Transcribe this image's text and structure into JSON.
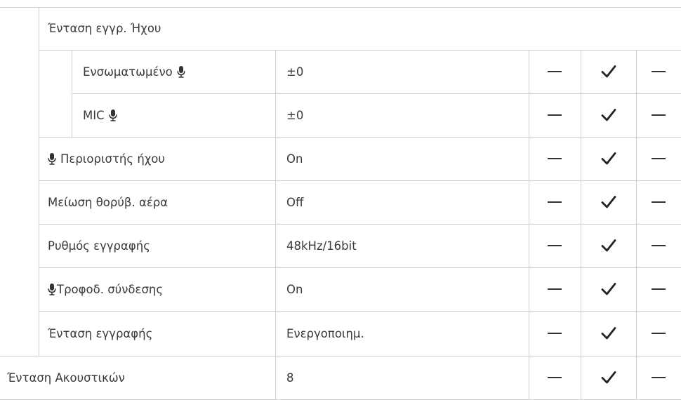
{
  "section_header": "Ένταση εγγρ. Ήχου",
  "columns": {
    "col1": "—",
    "col2": "check",
    "col3": "—"
  },
  "rows": [
    {
      "label": "Ενσωματωμένο",
      "value": "±0",
      "icon": "mic-icon",
      "icon_position": "after",
      "col1": "—",
      "col2": "check",
      "col3": "—"
    },
    {
      "label": "MIC",
      "value": "±0",
      "icon": "mic-icon",
      "icon_position": "after",
      "col1": "—",
      "col2": "check",
      "col3": "—"
    },
    {
      "label": "Περιοριστής ήχου",
      "value": "On",
      "icon": "mic-icon",
      "icon_position": "before",
      "col1": "—",
      "col2": "check",
      "col3": "—"
    },
    {
      "label": "Μείωση θορύβ. αέρα",
      "value": "Off",
      "col1": "—",
      "col2": "check",
      "col3": "—"
    },
    {
      "label": "Ρυθμός εγγραφής",
      "value": "48kHz/16bit",
      "col1": "—",
      "col2": "check",
      "col3": "—"
    },
    {
      "label": "Τροφοδ. σύνδεσης",
      "value": "On",
      "icon": "mic-icon",
      "icon_position": "before",
      "col1": "—",
      "col2": "check",
      "col3": "—"
    },
    {
      "label": "Ένταση εγγραφής",
      "value": "Ενεργοποιημ.",
      "col1": "—",
      "col2": "check",
      "col3": "—"
    },
    {
      "label": "Ένταση Ακουστικών",
      "value": "8",
      "col1": "—",
      "col2": "check",
      "col3": "—"
    }
  ],
  "colors": {
    "border": "#cfcfcf",
    "text": "#3a3a3a",
    "mark": "#222222"
  }
}
